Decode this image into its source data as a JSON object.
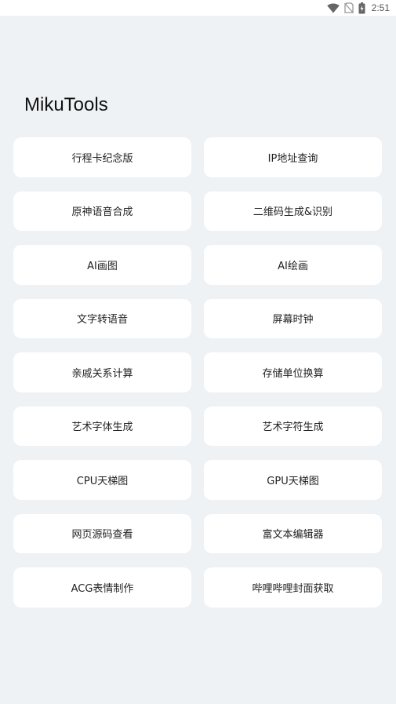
{
  "status_bar": {
    "time": "2:51",
    "icons": [
      "wifi-icon",
      "no-sim-icon",
      "battery-charging-icon"
    ]
  },
  "app": {
    "title": "MikuTools"
  },
  "tools": [
    {
      "label": "行程卡纪念版"
    },
    {
      "label": "IP地址查询"
    },
    {
      "label": "原神语音合成"
    },
    {
      "label": "二维码生成&识别"
    },
    {
      "label": "AI画图"
    },
    {
      "label": "AI绘画"
    },
    {
      "label": "文字转语音"
    },
    {
      "label": "屏幕时钟"
    },
    {
      "label": "亲戚关系计算"
    },
    {
      "label": "存储单位换算"
    },
    {
      "label": "艺术字体生成"
    },
    {
      "label": "艺术字符生成"
    },
    {
      "label": "CPU天梯图"
    },
    {
      "label": "GPU天梯图"
    },
    {
      "label": "网页源码查看"
    },
    {
      "label": "富文本编辑器"
    },
    {
      "label": "ACG表情制作"
    },
    {
      "label": "哔哩哔哩封面获取"
    }
  ],
  "colors": {
    "background": "#eef2f5",
    "tile": "#ffffff",
    "text": "#222222"
  }
}
